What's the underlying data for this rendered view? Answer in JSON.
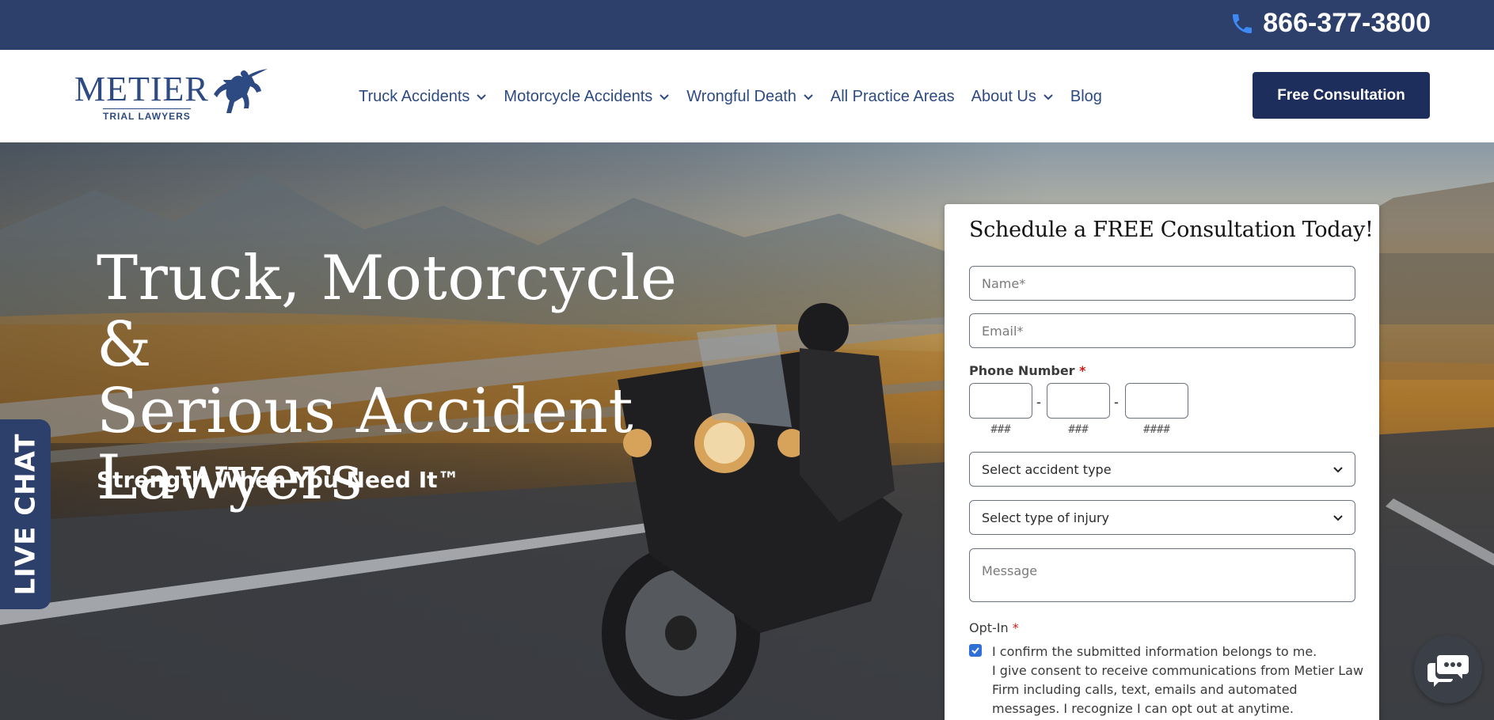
{
  "topbar": {
    "phone": "866-377-3800",
    "phone_icon": "phone-icon"
  },
  "header": {
    "logo": {
      "name": "METIER",
      "tagline": "TRIAL LAWYERS"
    },
    "nav": [
      {
        "label": "Truck Accidents",
        "has_dropdown": true
      },
      {
        "label": "Motorcycle Accidents",
        "has_dropdown": true
      },
      {
        "label": "Wrongful Death",
        "has_dropdown": true
      },
      {
        "label": "All Practice Areas",
        "has_dropdown": false
      },
      {
        "label": "About Us",
        "has_dropdown": true
      },
      {
        "label": "Blog",
        "has_dropdown": false
      }
    ],
    "cta_label": "Free Consultation"
  },
  "hero": {
    "title_line1": "Truck, Motorcycle &",
    "title_line2": "Serious Accident",
    "title_line3": "Lawyers",
    "subtitle": "Strength When You Need It™"
  },
  "live_chat": {
    "label": "LIVE CHAT"
  },
  "form": {
    "title": "Schedule a FREE Consultation Today!",
    "name_placeholder": "Name*",
    "email_placeholder": "Email*",
    "phone_label": "Phone Number",
    "required_mark": "*",
    "phone_hints": [
      "###",
      "###",
      "####"
    ],
    "phone_separator": "-",
    "accident_select": "Select accident type",
    "injury_select": "Select type of injury",
    "message_placeholder": "Message",
    "optin_label": "Opt-In",
    "optin_checked": true,
    "consent_line1": "I confirm the submitted information belongs to me.",
    "consent_line2": "I give consent to receive communications from Metier Law Firm including calls, text, emails and automated messages. I recognize I can opt out at anytime."
  },
  "colors": {
    "topbar": "#2d3f6b",
    "brand_blue": "#2d4a82",
    "cta": "#1e2e5c",
    "required": "#d01818",
    "checkbox": "#2f6fd6"
  }
}
